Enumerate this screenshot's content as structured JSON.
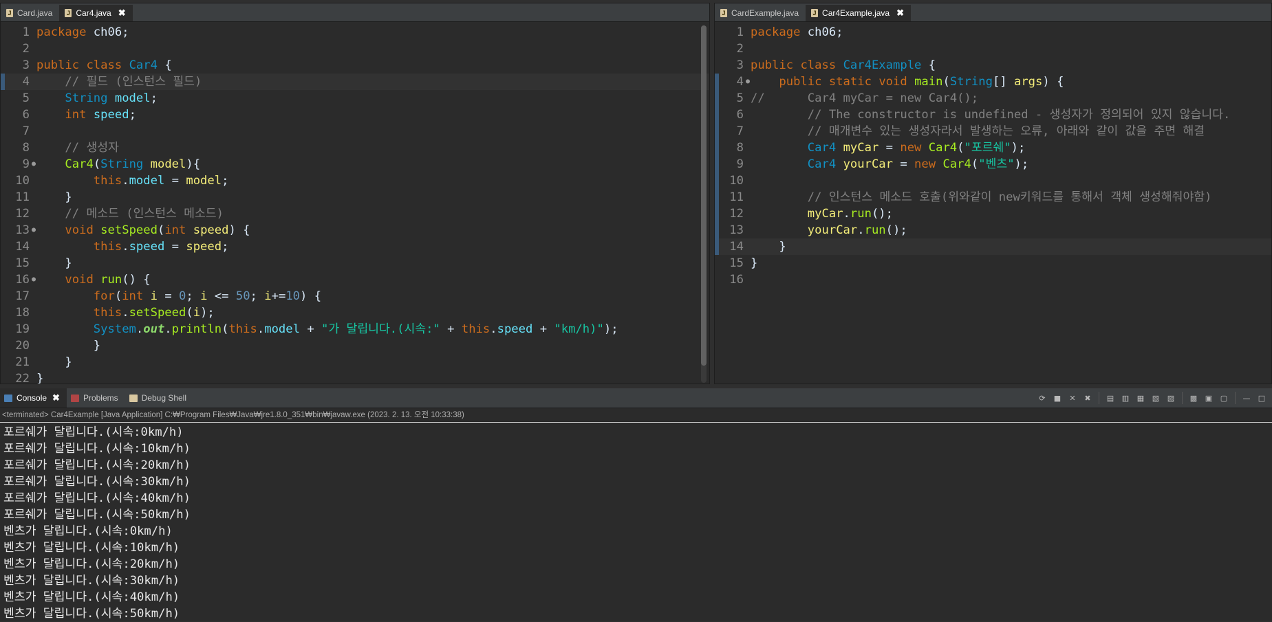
{
  "left_editor": {
    "tabs": [
      {
        "label": "Card.java",
        "active": false
      },
      {
        "label": "Car4.java",
        "active": true,
        "close": "✖"
      }
    ],
    "lines": [
      {
        "n": "1",
        "t": [
          [
            "kw",
            "package"
          ],
          [
            "plain",
            " ch06;"
          ]
        ]
      },
      {
        "n": "2",
        "t": []
      },
      {
        "n": "3",
        "t": [
          [
            "kw",
            "public"
          ],
          [
            "plain",
            " "
          ],
          [
            "kw",
            "class"
          ],
          [
            "plain",
            " "
          ],
          [
            "type",
            "Car4"
          ],
          [
            "plain",
            " {"
          ]
        ]
      },
      {
        "n": "4",
        "mark": true,
        "cur": true,
        "t": [
          [
            "plain",
            "    "
          ],
          [
            "cmt",
            "// 필드 (인스턴스 필드)"
          ]
        ]
      },
      {
        "n": "5",
        "t": [
          [
            "plain",
            "    "
          ],
          [
            "type",
            "String"
          ],
          [
            "plain",
            " "
          ],
          [
            "fld",
            "model"
          ],
          [
            "plain",
            ";"
          ]
        ]
      },
      {
        "n": "6",
        "t": [
          [
            "plain",
            "    "
          ],
          [
            "kw",
            "int"
          ],
          [
            "plain",
            " "
          ],
          [
            "fld",
            "speed"
          ],
          [
            "plain",
            ";"
          ]
        ]
      },
      {
        "n": "7",
        "t": []
      },
      {
        "n": "8",
        "t": [
          [
            "plain",
            "    "
          ],
          [
            "cmt",
            "// 생성자"
          ]
        ]
      },
      {
        "n": "9",
        "dot": true,
        "t": [
          [
            "plain",
            "    "
          ],
          [
            "meth",
            "Car4"
          ],
          [
            "plain",
            "("
          ],
          [
            "type",
            "String"
          ],
          [
            "plain",
            " "
          ],
          [
            "var",
            "model"
          ],
          [
            "plain",
            "){"
          ]
        ]
      },
      {
        "n": "10",
        "t": [
          [
            "plain",
            "        "
          ],
          [
            "kw",
            "this"
          ],
          [
            "plain",
            "."
          ],
          [
            "fld",
            "model"
          ],
          [
            "plain",
            " = "
          ],
          [
            "var",
            "model"
          ],
          [
            "plain",
            ";"
          ]
        ]
      },
      {
        "n": "11",
        "t": [
          [
            "plain",
            "    }"
          ]
        ]
      },
      {
        "n": "12",
        "t": [
          [
            "plain",
            "    "
          ],
          [
            "cmt",
            "// 메소드 (인스턴스 메소드)"
          ]
        ]
      },
      {
        "n": "13",
        "dot": true,
        "t": [
          [
            "plain",
            "    "
          ],
          [
            "kw",
            "void"
          ],
          [
            "plain",
            " "
          ],
          [
            "meth",
            "setSpeed"
          ],
          [
            "plain",
            "("
          ],
          [
            "kw",
            "int"
          ],
          [
            "plain",
            " "
          ],
          [
            "var",
            "speed"
          ],
          [
            "plain",
            ") {"
          ]
        ]
      },
      {
        "n": "14",
        "t": [
          [
            "plain",
            "        "
          ],
          [
            "kw",
            "this"
          ],
          [
            "plain",
            "."
          ],
          [
            "fld",
            "speed"
          ],
          [
            "plain",
            " = "
          ],
          [
            "var",
            "speed"
          ],
          [
            "plain",
            ";"
          ]
        ]
      },
      {
        "n": "15",
        "t": [
          [
            "plain",
            "    }"
          ]
        ]
      },
      {
        "n": "16",
        "dot": true,
        "t": [
          [
            "plain",
            "    "
          ],
          [
            "kw",
            "void"
          ],
          [
            "plain",
            " "
          ],
          [
            "meth",
            "run"
          ],
          [
            "plain",
            "() {"
          ]
        ]
      },
      {
        "n": "17",
        "t": [
          [
            "plain",
            "        "
          ],
          [
            "kw",
            "for"
          ],
          [
            "plain",
            "("
          ],
          [
            "kw",
            "int"
          ],
          [
            "plain",
            " "
          ],
          [
            "var",
            "i"
          ],
          [
            "plain",
            " = "
          ],
          [
            "num",
            "0"
          ],
          [
            "plain",
            "; "
          ],
          [
            "var",
            "i"
          ],
          [
            "plain",
            " <= "
          ],
          [
            "num",
            "50"
          ],
          [
            "plain",
            "; "
          ],
          [
            "var",
            "i"
          ],
          [
            "plain",
            "+="
          ],
          [
            "num",
            "10"
          ],
          [
            "plain",
            ") {"
          ]
        ]
      },
      {
        "n": "18",
        "t": [
          [
            "plain",
            "        "
          ],
          [
            "kw",
            "this"
          ],
          [
            "plain",
            "."
          ],
          [
            "meth",
            "setSpeed"
          ],
          [
            "plain",
            "("
          ],
          [
            "var",
            "i"
          ],
          [
            "plain",
            ");"
          ]
        ]
      },
      {
        "n": "19",
        "t": [
          [
            "plain",
            "        "
          ],
          [
            "type",
            "System"
          ],
          [
            "plain",
            "."
          ],
          [
            "static",
            "out"
          ],
          [
            "plain",
            "."
          ],
          [
            "meth",
            "println"
          ],
          [
            "plain",
            "("
          ],
          [
            "kw",
            "this"
          ],
          [
            "plain",
            "."
          ],
          [
            "fld",
            "model"
          ],
          [
            "plain",
            " + "
          ],
          [
            "str",
            "\"가 달립니다.(시속:\""
          ],
          [
            "plain",
            " + "
          ],
          [
            "kw",
            "this"
          ],
          [
            "plain",
            "."
          ],
          [
            "fld",
            "speed"
          ],
          [
            "plain",
            " + "
          ],
          [
            "str",
            "\"km/h)\""
          ],
          [
            "plain",
            ");"
          ]
        ]
      },
      {
        "n": "20",
        "t": [
          [
            "plain",
            "        }"
          ]
        ]
      },
      {
        "n": "21",
        "t": [
          [
            "plain",
            "    }"
          ]
        ]
      },
      {
        "n": "22",
        "t": [
          [
            "plain",
            "}"
          ]
        ]
      }
    ]
  },
  "right_editor": {
    "tabs": [
      {
        "label": "CardExample.java",
        "active": false
      },
      {
        "label": "Car4Example.java",
        "active": true,
        "close": "✖"
      }
    ],
    "lines": [
      {
        "n": "1",
        "t": [
          [
            "kw",
            "package"
          ],
          [
            "plain",
            " ch06;"
          ]
        ]
      },
      {
        "n": "2",
        "t": []
      },
      {
        "n": "3",
        "t": [
          [
            "kw",
            "public"
          ],
          [
            "plain",
            " "
          ],
          [
            "kw",
            "class"
          ],
          [
            "plain",
            " "
          ],
          [
            "type",
            "Car4Example"
          ],
          [
            "plain",
            " {"
          ]
        ]
      },
      {
        "n": "4",
        "mark": true,
        "dot": true,
        "t": [
          [
            "plain",
            "    "
          ],
          [
            "kw",
            "public"
          ],
          [
            "plain",
            " "
          ],
          [
            "kw",
            "static"
          ],
          [
            "plain",
            " "
          ],
          [
            "kw",
            "void"
          ],
          [
            "plain",
            " "
          ],
          [
            "meth",
            "main"
          ],
          [
            "plain",
            "("
          ],
          [
            "type",
            "String"
          ],
          [
            "plain",
            "[] "
          ],
          [
            "var",
            "args"
          ],
          [
            "plain",
            ") {"
          ]
        ]
      },
      {
        "n": "5",
        "mark": true,
        "t": [
          [
            "cmt",
            "//      Car4 myCar = new Car4();"
          ]
        ]
      },
      {
        "n": "6",
        "mark": true,
        "t": [
          [
            "plain",
            "        "
          ],
          [
            "cmt",
            "// The constructor is undefined - 생성자가 정의되어 있지 않습니다."
          ]
        ]
      },
      {
        "n": "7",
        "mark": true,
        "t": [
          [
            "plain",
            "        "
          ],
          [
            "cmt",
            "// 매개변수 있는 생성자라서 발생하는 오류, 아래와 같이 값을 주면 해결"
          ]
        ]
      },
      {
        "n": "8",
        "mark": true,
        "t": [
          [
            "plain",
            "        "
          ],
          [
            "type",
            "Car4"
          ],
          [
            "plain",
            " "
          ],
          [
            "var",
            "myCar"
          ],
          [
            "plain",
            " = "
          ],
          [
            "kw",
            "new"
          ],
          [
            "plain",
            " "
          ],
          [
            "meth",
            "Car4"
          ],
          [
            "plain",
            "("
          ],
          [
            "str",
            "\"포르쉐\""
          ],
          [
            "plain",
            ");"
          ]
        ]
      },
      {
        "n": "9",
        "mark": true,
        "t": [
          [
            "plain",
            "        "
          ],
          [
            "type",
            "Car4"
          ],
          [
            "plain",
            " "
          ],
          [
            "var",
            "yourCar"
          ],
          [
            "plain",
            " = "
          ],
          [
            "kw",
            "new"
          ],
          [
            "plain",
            " "
          ],
          [
            "meth",
            "Car4"
          ],
          [
            "plain",
            "("
          ],
          [
            "str",
            "\"벤츠\""
          ],
          [
            "plain",
            ");"
          ]
        ]
      },
      {
        "n": "10",
        "mark": true,
        "t": []
      },
      {
        "n": "11",
        "mark": true,
        "t": [
          [
            "plain",
            "        "
          ],
          [
            "cmt",
            "// 인스턴스 메소드 호출(위와같이 new키워드를 통해서 객체 생성해줘야함)"
          ]
        ]
      },
      {
        "n": "12",
        "mark": true,
        "t": [
          [
            "plain",
            "        "
          ],
          [
            "var",
            "myCar"
          ],
          [
            "plain",
            "."
          ],
          [
            "meth",
            "run"
          ],
          [
            "plain",
            "();"
          ]
        ]
      },
      {
        "n": "13",
        "mark": true,
        "t": [
          [
            "plain",
            "        "
          ],
          [
            "var",
            "yourCar"
          ],
          [
            "plain",
            "."
          ],
          [
            "meth",
            "run"
          ],
          [
            "plain",
            "();"
          ]
        ]
      },
      {
        "n": "14",
        "mark": true,
        "cur": true,
        "t": [
          [
            "plain",
            "    }"
          ]
        ]
      },
      {
        "n": "15",
        "t": [
          [
            "plain",
            "}"
          ]
        ]
      },
      {
        "n": "16",
        "t": []
      }
    ]
  },
  "console": {
    "tabs": [
      {
        "label": "Console",
        "active": true,
        "close": "✖",
        "color": "#4a7fb5"
      },
      {
        "label": "Problems",
        "active": false,
        "color": "#b04545"
      },
      {
        "label": "Debug Shell",
        "active": false,
        "color": "#d8c7a0"
      }
    ],
    "status": "<terminated> Car4Example [Java Application] C:₩Program Files₩Java₩jre1.8.0_351₩bin₩javaw.exe (2023. 2. 13. 오전 10:33:38)",
    "output": [
      "포르쉐가 달립니다.(시속:0km/h)",
      "포르쉐가 달립니다.(시속:10km/h)",
      "포르쉐가 달립니다.(시속:20km/h)",
      "포르쉐가 달립니다.(시속:30km/h)",
      "포르쉐가 달립니다.(시속:40km/h)",
      "포르쉐가 달립니다.(시속:50km/h)",
      "벤츠가 달립니다.(시속:0km/h)",
      "벤츠가 달립니다.(시속:10km/h)",
      "벤츠가 달립니다.(시속:20km/h)",
      "벤츠가 달립니다.(시속:30km/h)",
      "벤츠가 달립니다.(시속:40km/h)",
      "벤츠가 달립니다.(시속:50km/h)"
    ],
    "toolbar_icons": [
      "relaunch-icon",
      "terminate-icon",
      "remove-launch-icon",
      "remove-all-terminated-icon",
      "clear-console-icon",
      "scroll-lock-icon",
      "word-wrap-icon",
      "show-on-stdout-icon",
      "show-on-stderr-icon",
      "pin-console-icon",
      "display-console-icon",
      "open-console-icon",
      "minimize-icon",
      "maximize-icon"
    ]
  },
  "colors": {
    "keyword": "#cc6c1d",
    "type": "#1290c3",
    "variable": "#f3ec79",
    "field": "#66e1f8",
    "method": "#a7ec21",
    "string": "#17c6a3",
    "number": "#6897bb",
    "comment": "#808080",
    "background": "#2b2b2b"
  }
}
